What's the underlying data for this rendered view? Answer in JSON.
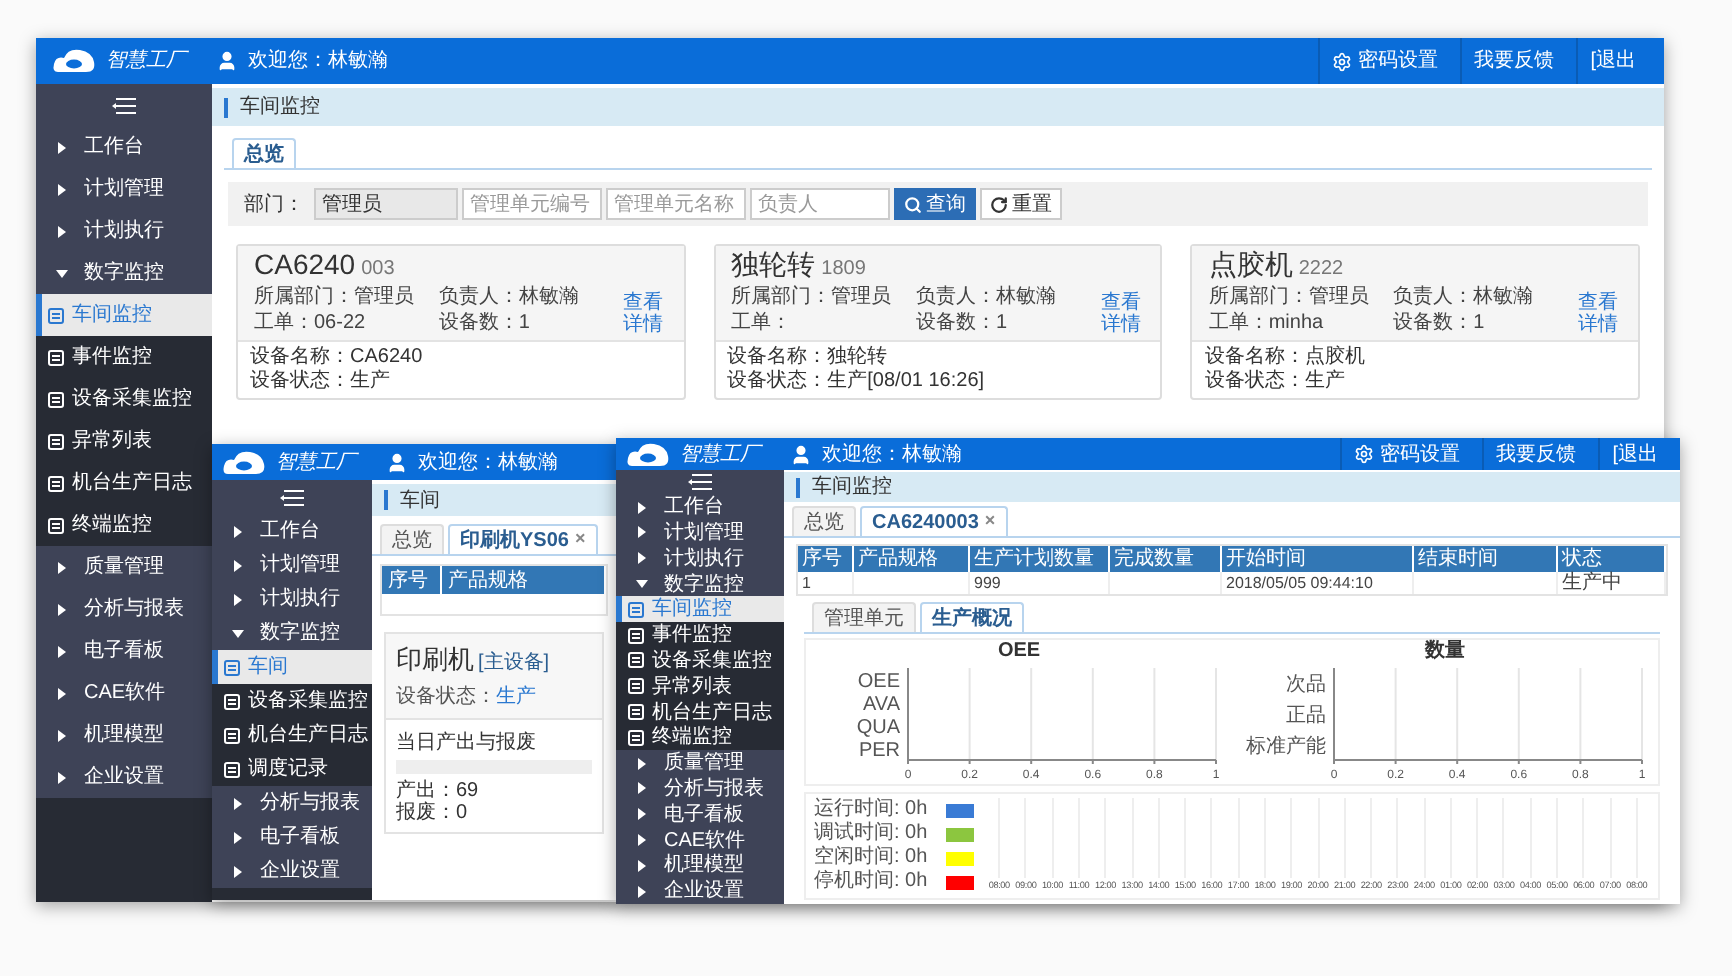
{
  "back_window": {
    "header": {
      "logo": "智慧工厂",
      "welcome": "欢迎您：林敏瀚",
      "actions": [
        {
          "label": "密码设置",
          "kind": "settings"
        },
        {
          "label": "我要反馈",
          "kind": "plain"
        },
        {
          "label": "[退出",
          "kind": "plain"
        }
      ]
    },
    "sidebar": {
      "items": [
        {
          "label": "工作台",
          "expanded": false,
          "selected": false
        },
        {
          "label": "计划管理",
          "expanded": false,
          "selected": false
        },
        {
          "label": "计划执行",
          "expanded": false,
          "selected": false
        },
        {
          "label": "数字监控",
          "expanded": true,
          "selected": false,
          "children": [
            {
              "label": "车间监控",
              "selected": true
            },
            {
              "label": "事件监控",
              "selected": false
            },
            {
              "label": "设备采集监控",
              "selected": false
            },
            {
              "label": "异常列表",
              "selected": false
            },
            {
              "label": "机台生产日志",
              "selected": false
            },
            {
              "label": "终端监控",
              "selected": false
            }
          ]
        },
        {
          "label": "质量管理",
          "expanded": false,
          "selected": false
        },
        {
          "label": "分析与报表",
          "expanded": false,
          "selected": false
        },
        {
          "label": "电子看板",
          "expanded": false,
          "selected": false
        },
        {
          "label": "CAE软件",
          "expanded": false,
          "selected": false
        },
        {
          "label": "机理模型",
          "expanded": false,
          "selected": false
        },
        {
          "label": "企业设置",
          "expanded": false,
          "selected": false
        }
      ]
    },
    "breadcrumb": "车间监控",
    "tabs": [
      {
        "label": "总览",
        "selected": true
      }
    ],
    "filter": {
      "label": "部门：",
      "department": "管理员",
      "fields": [
        {
          "placeholder": "管理单元编号"
        },
        {
          "placeholder": "管理单元名称"
        },
        {
          "placeholder": "负责人"
        }
      ],
      "buttons": [
        {
          "label": "查询",
          "kind": "primary"
        },
        {
          "label": "重置",
          "kind": "reset"
        }
      ]
    },
    "cards": [
      {
        "name": "CA6240",
        "code": "003",
        "department": "所属部门：管理员",
        "owner": "负责人：林敏瀚",
        "order": "工单：06-22",
        "device_count": "设备数：1",
        "link": "查看详情",
        "device_name": "设备名称：CA6240",
        "device_status": "设备状态：生产"
      },
      {
        "name": "独轮转",
        "code": "1809",
        "department": "所属部门：管理员",
        "owner": "负责人：林敏瀚",
        "order": "工单：",
        "device_count": "设备数：1",
        "link": "查看详情",
        "device_name": "设备名称：独轮转",
        "device_status": "设备状态：生产[08/01 16:26]"
      },
      {
        "name": "点胶机",
        "code": "2222",
        "department": "所属部门：管理员",
        "owner": "负责人：林敏瀚",
        "order": "工单：minha",
        "device_count": "设备数：1",
        "link": "查看详情",
        "device_name": "设备名称：点胶机",
        "device_status": "设备状态：生产"
      }
    ]
  },
  "middle_window": {
    "header": {
      "logo": "智慧工厂",
      "welcome": "欢迎您：林敏瀚"
    },
    "sidebar": {
      "items": [
        {
          "label": "工作台",
          "expanded": false,
          "selected": false
        },
        {
          "label": "计划管理",
          "expanded": false,
          "selected": false
        },
        {
          "label": "计划执行",
          "expanded": false,
          "selected": false
        },
        {
          "label": "数字监控",
          "expanded": true,
          "selected": false,
          "children": [
            {
              "label": "车间",
              "selected": true
            },
            {
              "label": "设备采集监控",
              "selected": false
            },
            {
              "label": "机台生产日志",
              "selected": false
            },
            {
              "label": "调度记录",
              "selected": false
            }
          ]
        },
        {
          "label": "分析与报表",
          "expanded": false,
          "selected": false
        },
        {
          "label": "电子看板",
          "expanded": false,
          "selected": false
        },
        {
          "label": "企业设置",
          "expanded": false,
          "selected": false
        }
      ]
    },
    "breadcrumb": "车间",
    "tabs": [
      {
        "label": "总览",
        "selected": false
      },
      {
        "label": "印刷机YS06",
        "close": "×",
        "selected": true
      }
    ],
    "table": {
      "columns": [
        "序号",
        "产品规格"
      ]
    },
    "device": {
      "name": "印刷机",
      "tag": "[主设备]",
      "status_label": "设备状态：",
      "status": "生产",
      "output_title": "当日产出与报废",
      "level": 0,
      "output": "产出：69",
      "scrap": "报废：0"
    }
  },
  "front_window": {
    "header": {
      "logo": "智慧工厂",
      "welcome": "欢迎您：林敏瀚",
      "actions": [
        {
          "label": "密码设置",
          "kind": "settings"
        },
        {
          "label": "我要反馈",
          "kind": "plain"
        },
        {
          "label": "[退出",
          "kind": "plain"
        }
      ]
    },
    "sidebar": {
      "items": [
        {
          "label": "工作台",
          "expanded": false,
          "selected": false
        },
        {
          "label": "计划管理",
          "expanded": false,
          "selected": false
        },
        {
          "label": "计划执行",
          "expanded": false,
          "selected": false
        },
        {
          "label": "数字监控",
          "expanded": true,
          "selected": false,
          "children": [
            {
              "label": "车间监控",
              "selected": true
            },
            {
              "label": "事件监控",
              "selected": false
            },
            {
              "label": "设备采集监控",
              "selected": false
            },
            {
              "label": "异常列表",
              "selected": false
            },
            {
              "label": "机台生产日志",
              "selected": false
            },
            {
              "label": "终端监控",
              "selected": false
            }
          ]
        },
        {
          "label": "质量管理",
          "expanded": false,
          "selected": false
        },
        {
          "label": "分析与报表",
          "expanded": false,
          "selected": false
        },
        {
          "label": "电子看板",
          "expanded": false,
          "selected": false
        },
        {
          "label": "CAE软件",
          "expanded": false,
          "selected": false
        },
        {
          "label": "机理模型",
          "expanded": false,
          "selected": false
        },
        {
          "label": "企业设置",
          "expanded": false,
          "selected": false
        }
      ]
    },
    "breadcrumb": "车间监控",
    "tabs": [
      {
        "label": "总览",
        "selected": false
      },
      {
        "label": "CA6240003",
        "close": "×",
        "selected": true
      }
    ],
    "table": {
      "columns": [
        "序号",
        "产品规格",
        "生产计划数量",
        "完成数量",
        "开始时间",
        "结束时间",
        "状态"
      ],
      "rows": [
        {
          "cells": [
            "1",
            null,
            "999",
            null,
            "2018/05/05 09:44:10",
            null,
            "生产中"
          ]
        }
      ]
    },
    "subtabs": [
      {
        "label": "管理单元",
        "selected": false
      },
      {
        "label": "生产概况",
        "selected": true
      }
    ],
    "charts": [
      {
        "chart_data": {
          "type": "bar",
          "orientation": "horizontal",
          "title": "OEE",
          "categories": [
            "OEE",
            "AVA",
            "QUA",
            "PER"
          ],
          "values": [
            0,
            0,
            0,
            0
          ],
          "xlim": [
            0,
            1
          ],
          "xticks": [
            0,
            0.2,
            0.4,
            0.6,
            0.8,
            1
          ],
          "grid": true
        }
      },
      {
        "chart_data": {
          "type": "bar",
          "orientation": "horizontal",
          "title": "数量",
          "categories": [
            "次品",
            "正品",
            "标准产能"
          ],
          "values": [
            0,
            0,
            0
          ],
          "xlim": [
            0,
            1
          ],
          "xticks": [
            0,
            0.2,
            0.4,
            0.6,
            0.8,
            1
          ],
          "grid": true
        }
      }
    ],
    "timeline": {
      "legend": [
        {
          "label": "运行时间: 0h",
          "color": "#3a7bd5"
        },
        {
          "label": "调试时间: 0h",
          "color": "#8cc63f"
        },
        {
          "label": "空闲时间: 0h",
          "color": "#ffff00"
        },
        {
          "label": "停机时间: 0h",
          "color": "#ff0000"
        }
      ],
      "time_labels": [
        "08:00",
        "09:00",
        "10:00",
        "11:00",
        "12:00",
        "13:00",
        "14:00",
        "15:00",
        "16:00",
        "17:00",
        "18:00",
        "19:00",
        "20:00",
        "21:00",
        "22:00",
        "23:00",
        "24:00",
        "01:00",
        "02:00",
        "03:00",
        "04:00",
        "05:00",
        "06:00",
        "07:00",
        "08:00"
      ]
    }
  }
}
